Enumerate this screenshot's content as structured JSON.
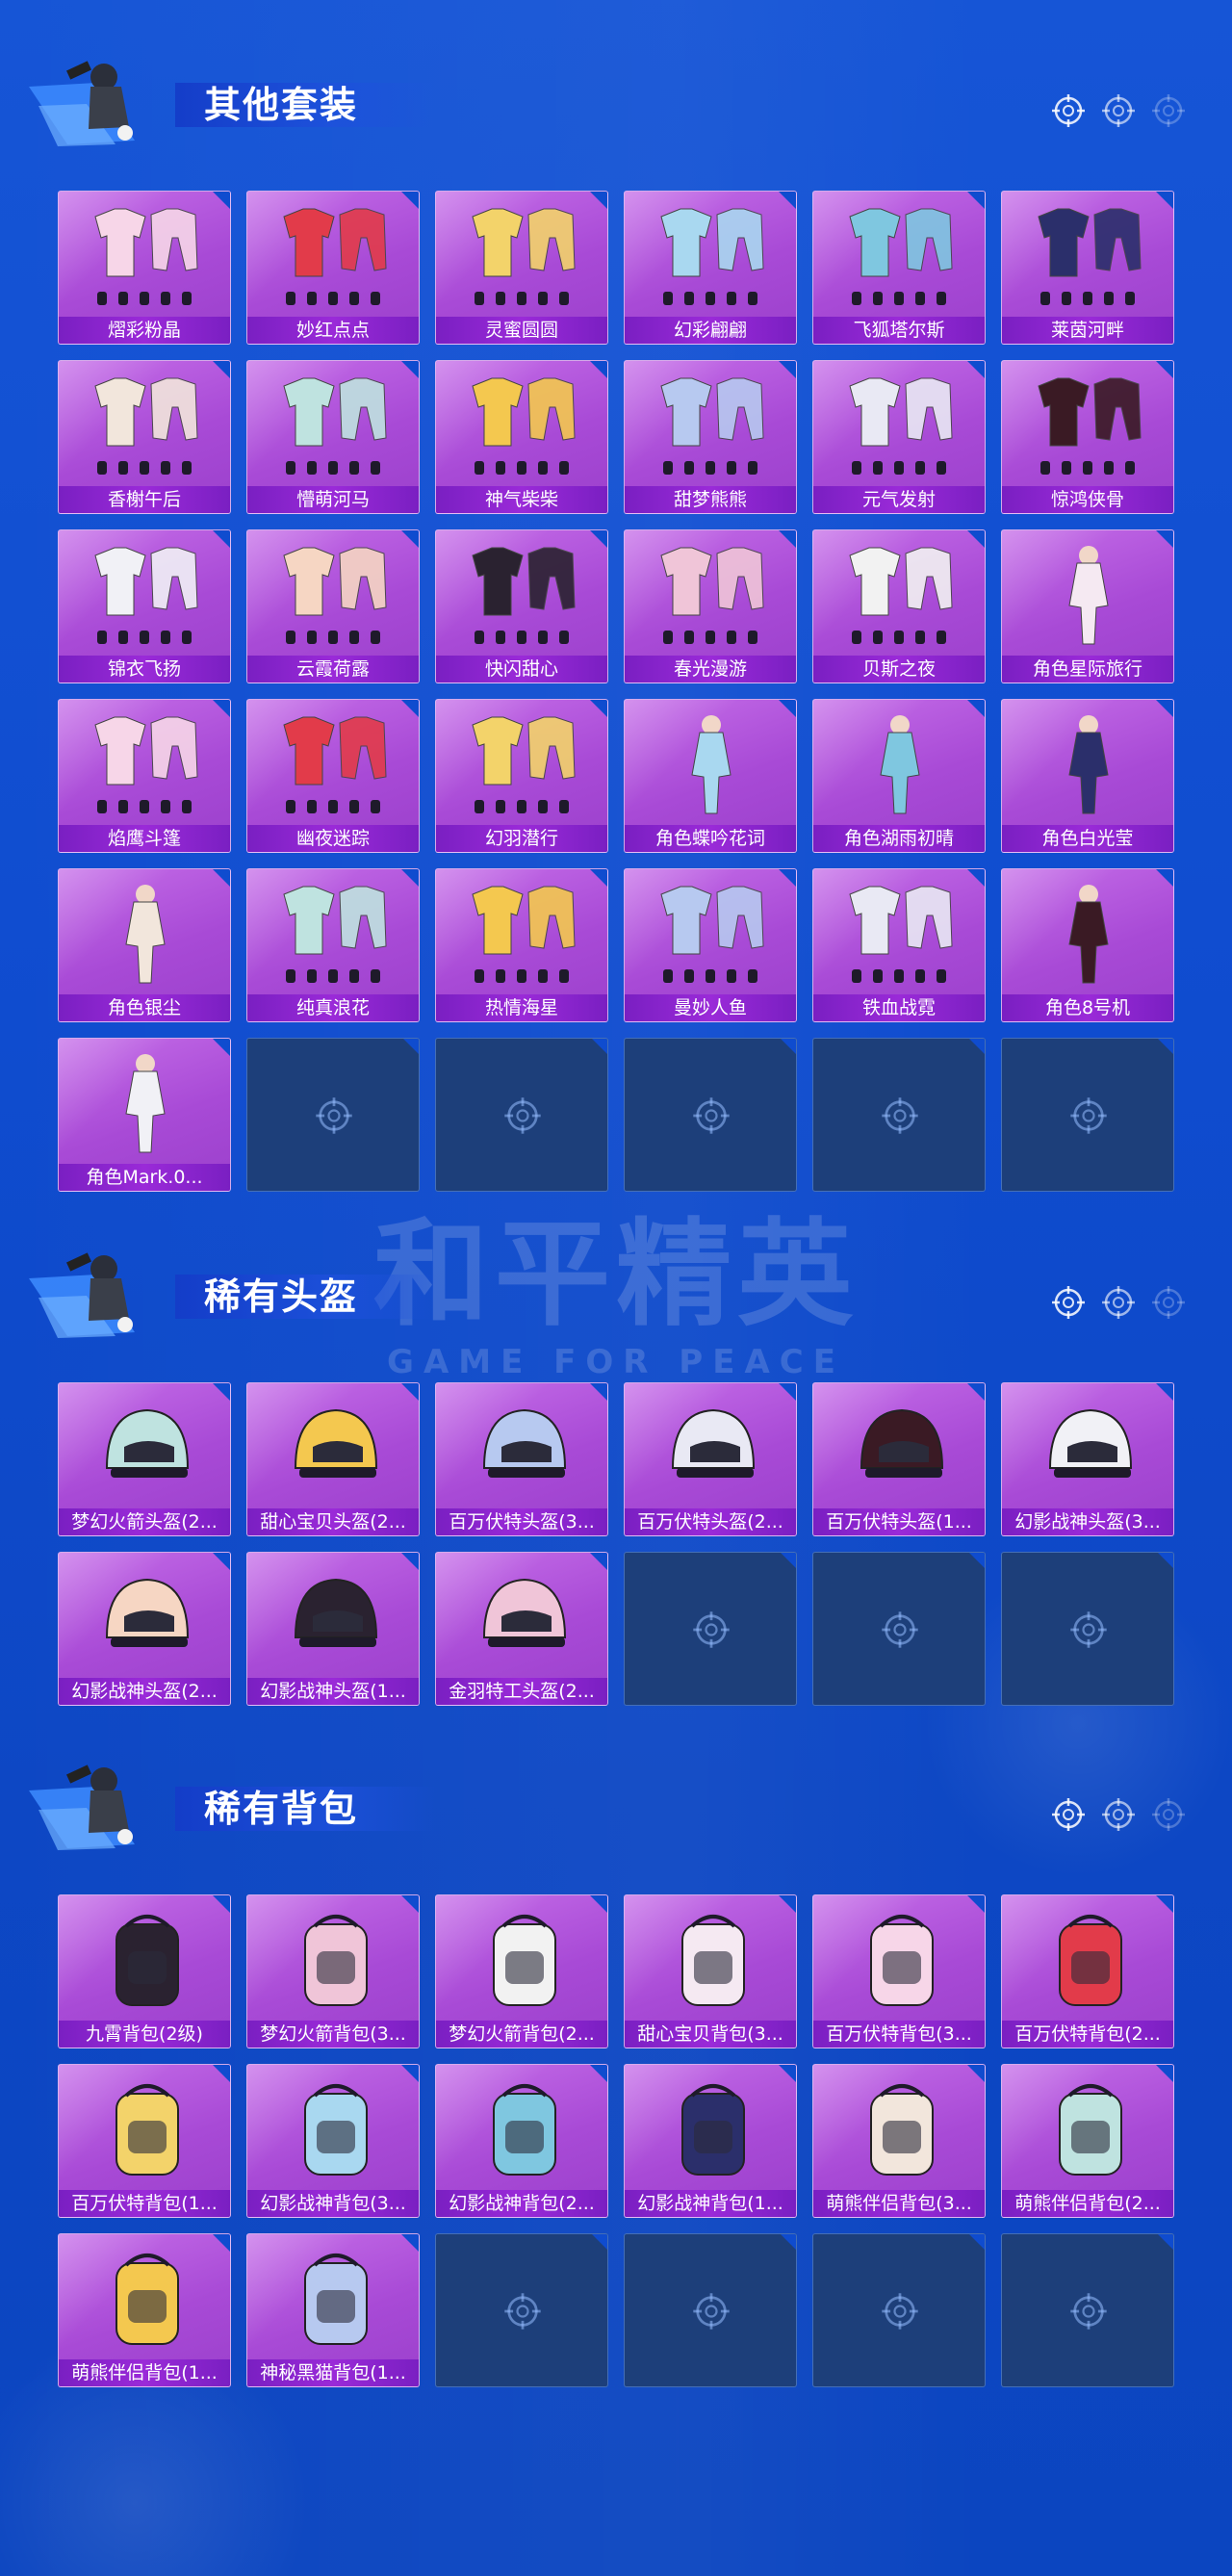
{
  "colors": {
    "background": "#1655d6",
    "card": "#b05ad8",
    "label_bar": "#8a24cc",
    "empty_card": "#1d3f7a"
  },
  "watermark": {
    "main": "和平精英",
    "sub": "GAME FOR PEACE"
  },
  "sections": [
    {
      "title": "其他套装",
      "items": [
        {
          "label": "熠彩粉晶",
          "kind": "outfit"
        },
        {
          "label": "妙红点点",
          "kind": "outfit"
        },
        {
          "label": "灵蜜圆圆",
          "kind": "outfit"
        },
        {
          "label": "幻彩翩翩",
          "kind": "outfit"
        },
        {
          "label": "飞狐塔尔斯",
          "kind": "outfit"
        },
        {
          "label": "莱茵河畔",
          "kind": "outfit"
        },
        {
          "label": "香榭午后",
          "kind": "outfit"
        },
        {
          "label": "懵萌河马",
          "kind": "outfit"
        },
        {
          "label": "神气柴柴",
          "kind": "outfit"
        },
        {
          "label": "甜梦熊熊",
          "kind": "outfit"
        },
        {
          "label": "元气发射",
          "kind": "outfit"
        },
        {
          "label": "惊鸿侠骨",
          "kind": "outfit"
        },
        {
          "label": "锦衣飞扬",
          "kind": "outfit"
        },
        {
          "label": "云霞荷露",
          "kind": "outfit"
        },
        {
          "label": "快闪甜心",
          "kind": "outfit"
        },
        {
          "label": "春光漫游",
          "kind": "outfit"
        },
        {
          "label": "贝斯之夜",
          "kind": "outfit"
        },
        {
          "label": "角色星际旅行",
          "kind": "character"
        },
        {
          "label": "焰鹰斗篷",
          "kind": "outfit"
        },
        {
          "label": "幽夜迷踪",
          "kind": "outfit"
        },
        {
          "label": "幻羽潜行",
          "kind": "outfit"
        },
        {
          "label": "角色蝶吟花词",
          "kind": "character"
        },
        {
          "label": "角色湖雨初晴",
          "kind": "character"
        },
        {
          "label": "角色白光莹",
          "kind": "character"
        },
        {
          "label": "角色银尘",
          "kind": "character"
        },
        {
          "label": "纯真浪花",
          "kind": "outfit"
        },
        {
          "label": "热情海星",
          "kind": "outfit"
        },
        {
          "label": "曼妙人鱼",
          "kind": "outfit"
        },
        {
          "label": "铁血战霓",
          "kind": "outfit"
        },
        {
          "label": "角色8号机",
          "kind": "character"
        },
        {
          "label": "角色Mark.0...",
          "kind": "character"
        }
      ],
      "empty_slots": 5
    },
    {
      "title": "稀有头盔",
      "items": [
        {
          "label": "梦幻火箭头盔(2...",
          "kind": "helmet"
        },
        {
          "label": "甜心宝贝头盔(2...",
          "kind": "helmet"
        },
        {
          "label": "百万伏特头盔(3...",
          "kind": "helmet"
        },
        {
          "label": "百万伏特头盔(2...",
          "kind": "helmet"
        },
        {
          "label": "百万伏特头盔(1...",
          "kind": "helmet"
        },
        {
          "label": "幻影战神头盔(3...",
          "kind": "helmet"
        },
        {
          "label": "幻影战神头盔(2...",
          "kind": "helmet"
        },
        {
          "label": "幻影战神头盔(1...",
          "kind": "helmet"
        },
        {
          "label": "金羽特工头盔(2...",
          "kind": "helmet"
        }
      ],
      "empty_slots": 3
    },
    {
      "title": "稀有背包",
      "items": [
        {
          "label": "九霄背包(2级)",
          "kind": "backpack"
        },
        {
          "label": "梦幻火箭背包(3...",
          "kind": "backpack"
        },
        {
          "label": "梦幻火箭背包(2...",
          "kind": "backpack"
        },
        {
          "label": "甜心宝贝背包(3...",
          "kind": "backpack"
        },
        {
          "label": "百万伏特背包(3...",
          "kind": "backpack"
        },
        {
          "label": "百万伏特背包(2...",
          "kind": "backpack"
        },
        {
          "label": "百万伏特背包(1...",
          "kind": "backpack"
        },
        {
          "label": "幻影战神背包(3...",
          "kind": "backpack"
        },
        {
          "label": "幻影战神背包(2...",
          "kind": "backpack"
        },
        {
          "label": "幻影战神背包(1...",
          "kind": "backpack"
        },
        {
          "label": "萌熊伴侣背包(3...",
          "kind": "backpack"
        },
        {
          "label": "萌熊伴侣背包(2...",
          "kind": "backpack"
        },
        {
          "label": "萌熊伴侣背包(1...",
          "kind": "backpack"
        },
        {
          "label": "神秘黑猫背包(1...",
          "kind": "backpack"
        }
      ],
      "empty_slots": 4
    }
  ]
}
